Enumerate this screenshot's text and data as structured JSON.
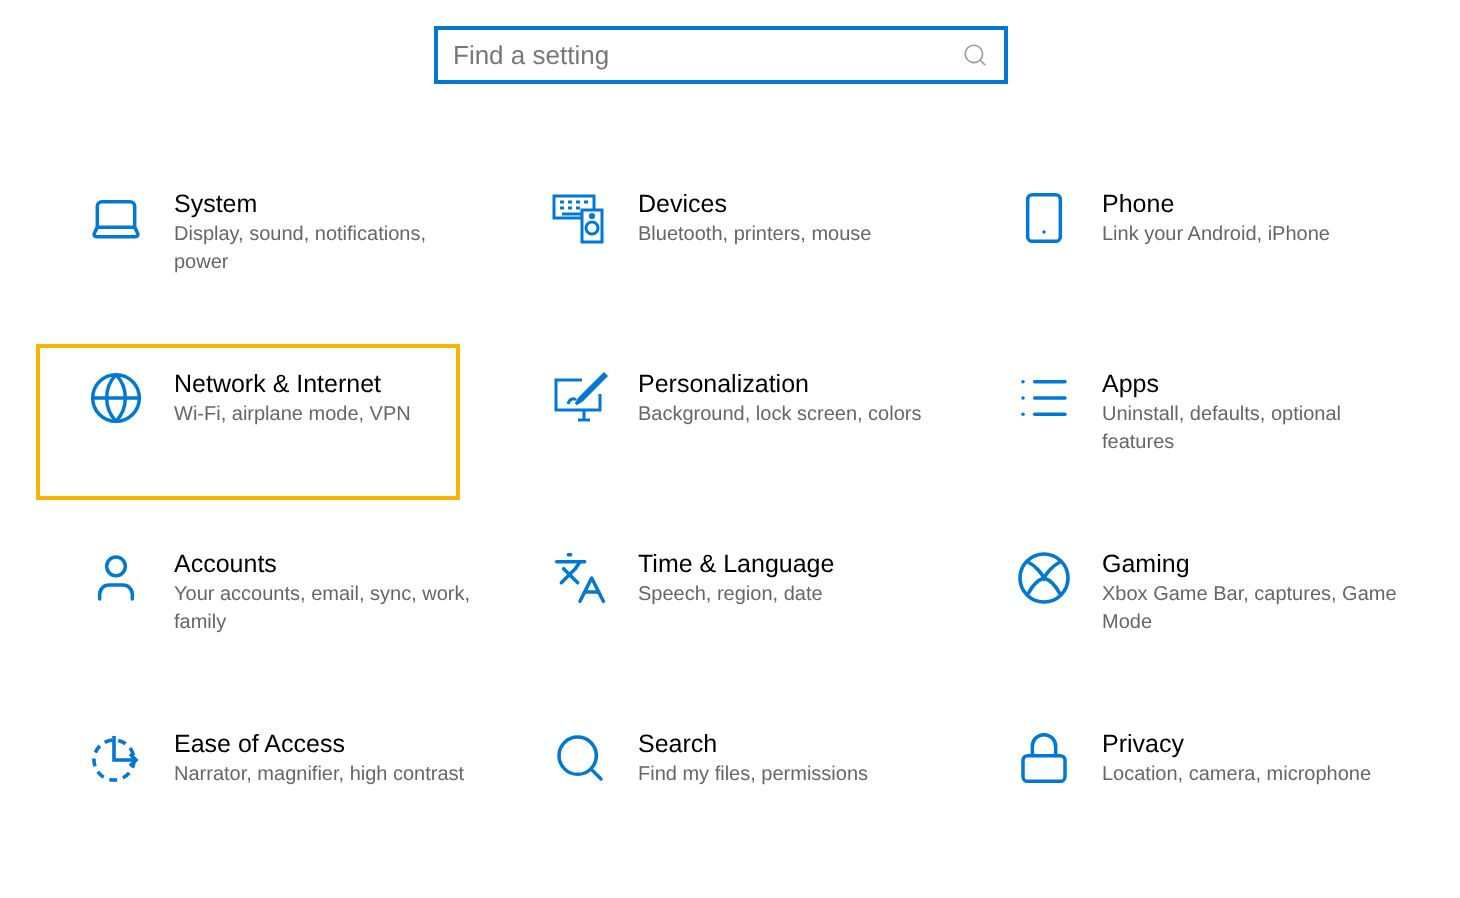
{
  "search": {
    "placeholder": "Find a setting"
  },
  "categories": [
    {
      "title": "System",
      "description": "Display, sound, notifications, power",
      "selected": false
    },
    {
      "title": "Devices",
      "description": "Bluetooth, printers, mouse",
      "selected": false
    },
    {
      "title": "Phone",
      "description": "Link your Android, iPhone",
      "selected": false
    },
    {
      "title": "Network & Internet",
      "description": "Wi-Fi, airplane mode, VPN",
      "selected": true
    },
    {
      "title": "Personalization",
      "description": "Background, lock screen, colors",
      "selected": false
    },
    {
      "title": "Apps",
      "description": "Uninstall, defaults, optional features",
      "selected": false
    },
    {
      "title": "Accounts",
      "description": "Your accounts, email, sync, work, family",
      "selected": false
    },
    {
      "title": "Time & Language",
      "description": "Speech, region, date",
      "selected": false
    },
    {
      "title": "Gaming",
      "description": "Xbox Game Bar, captures, Game Mode",
      "selected": false
    },
    {
      "title": "Ease of Access",
      "description": "Narrator, magnifier, high contrast",
      "selected": false
    },
    {
      "title": "Search",
      "description": "Find my files, permissions",
      "selected": false
    },
    {
      "title": "Privacy",
      "description": "Location, camera, microphone",
      "selected": false
    }
  ]
}
